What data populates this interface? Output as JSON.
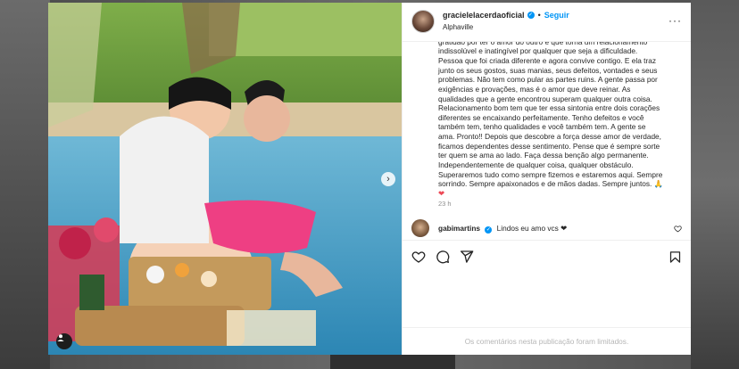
{
  "post": {
    "username": "gracielelacerdaoficial",
    "verified_mark": "✓",
    "separator": "•",
    "follow_label": "Seguir",
    "location": "Alphaville",
    "more_label": "···",
    "caption_lines": [
      "gratidão por ter o amor do outro é que torna um relacionamento",
      "indissolúvel e inatingível por qualquer que seja a dificuldade.",
      "Pessoa que foi criada diferente e agora convive contigo. E ela traz",
      "junto os seus gostos, suas manias, seus defeitos, vontades e seus",
      "problemas. Não tem como pular as partes ruins. A gente passa por",
      "exigências e provações, mas é o amor que deve reinar. As",
      "qualidades que a gente encontrou superam qualquer outra coisa.",
      "Relacionamento bom tem que ter essa sintonia entre dois corações",
      "diferentes se encaixando perfeitamente. Tenho defeitos e você",
      "também tem, tenho qualidades e você também tem. A gente se",
      "ama. Pronto!! Depois que descobre a força desse amor de verdade,",
      "ficamos dependentes desse sentimento. Pense que é sempre sorte",
      "ter quem se ama ao lado. Faça dessa benção algo permanente.",
      "Independentemente de qualquer coisa, qualquer obstáculo.",
      "Superaremos tudo como sempre fizemos e estaremos aqui. Sempre",
      "sorrindo. Sempre apaixonados e de mãos dadas. Sempre juntos. 🙏"
    ],
    "caption_end_emoji": "❤",
    "time_ago": "23 h",
    "comment": {
      "username": "gabimartins",
      "verified_mark": "✓",
      "text": "Lindos eu amo vcs ❤"
    },
    "comments_limited": "Os comentários nesta publicação foram limitados."
  },
  "icons": {
    "like": "heart-outline-icon",
    "comment": "speech-bubble-icon",
    "share": "paper-plane-icon",
    "save": "bookmark-icon",
    "next": "chevron-right-icon",
    "tag": "person-tag-icon"
  },
  "colors": {
    "accent": "#0095f6",
    "heart": "#ed4956",
    "text": "#262626",
    "muted": "#8e8e8e"
  }
}
